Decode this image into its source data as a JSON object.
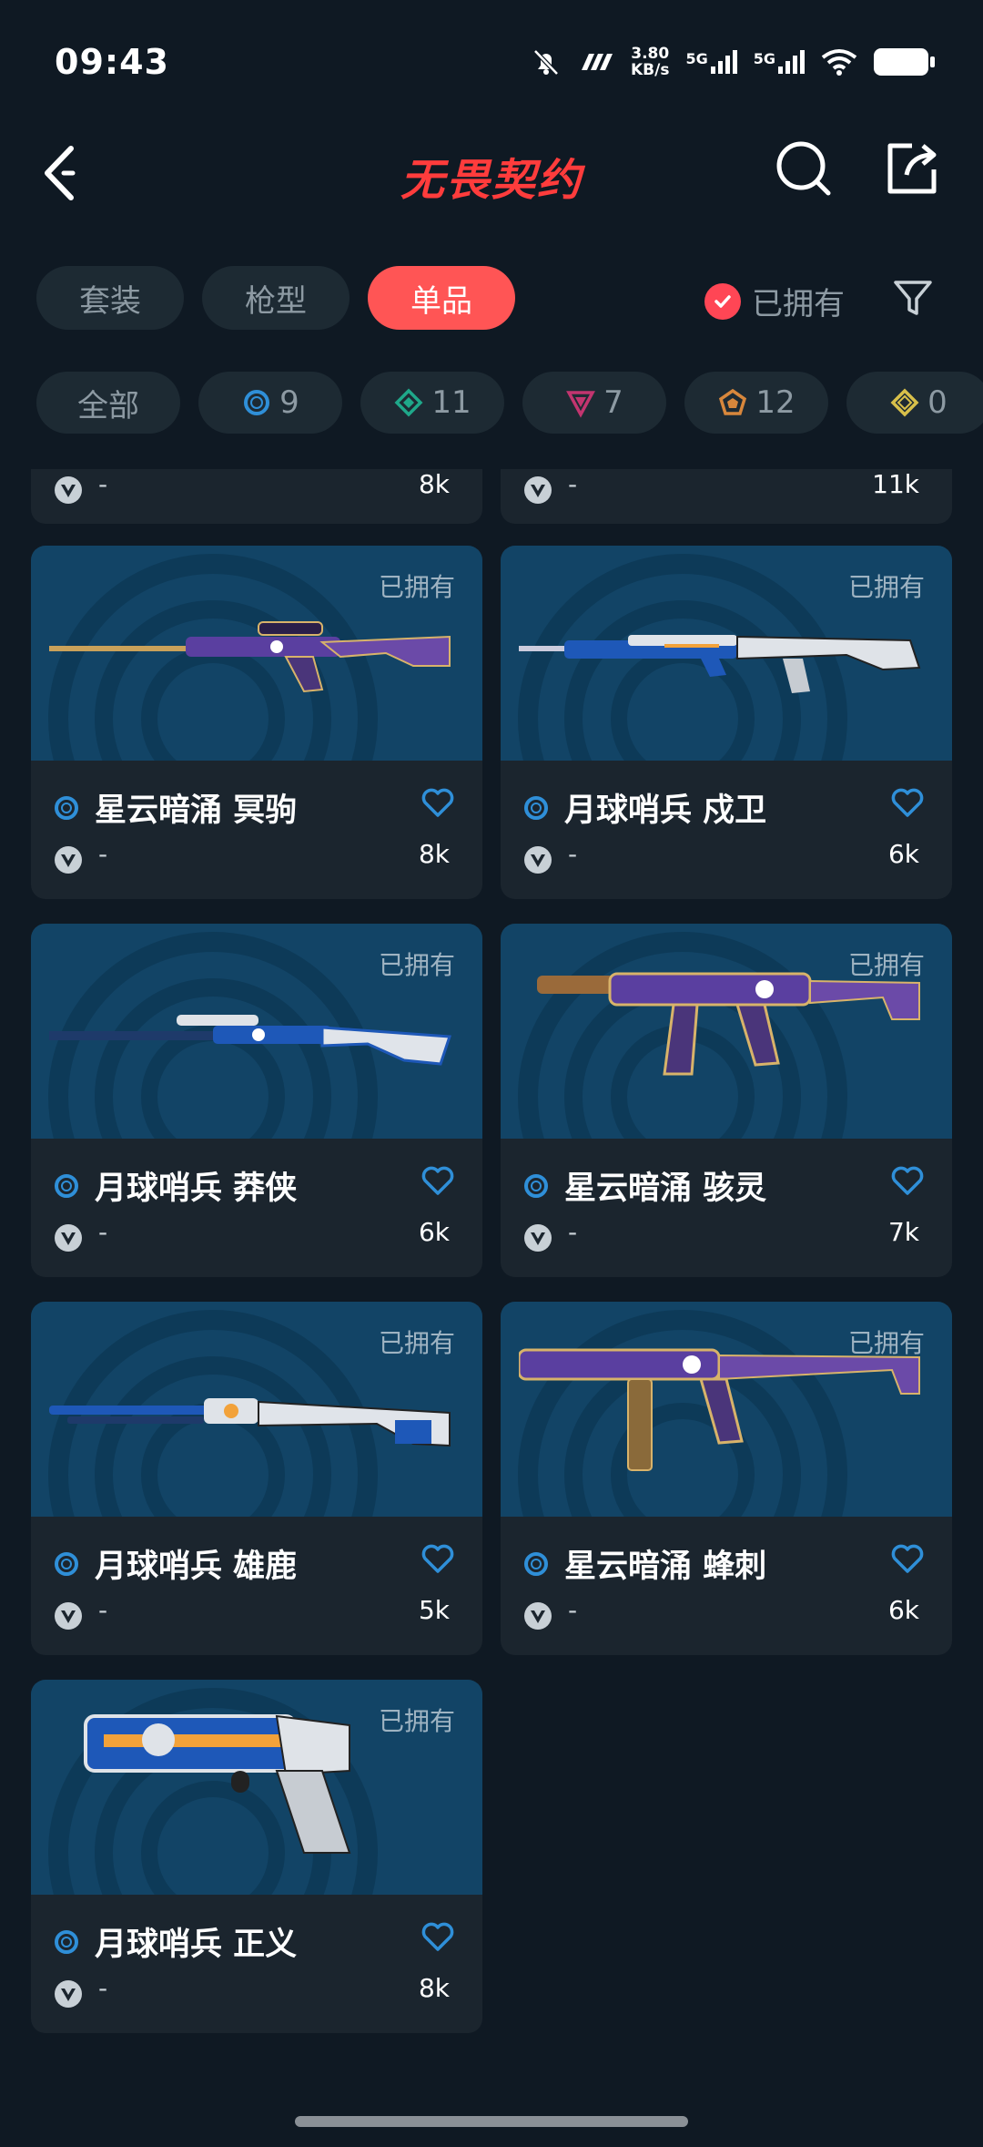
{
  "status_bar": {
    "time": "09:43",
    "net_speed_value": "3.80",
    "net_speed_unit": "KB/s",
    "sig1": "5G",
    "sig2": "5G"
  },
  "header": {
    "logo": "无畏契约"
  },
  "tabs": [
    {
      "label": "套装",
      "active": false
    },
    {
      "label": "枪型",
      "active": false
    },
    {
      "label": "单品",
      "active": true
    }
  ],
  "owned_toggle": {
    "label": "已拥有",
    "checked": true
  },
  "tier_filters": [
    {
      "label": "全部"
    },
    {
      "icon": "select-tier-icon",
      "color": "#2f8fd8",
      "count": "9"
    },
    {
      "icon": "deluxe-tier-icon",
      "color": "#1fa88a",
      "count": "11"
    },
    {
      "icon": "premium-tier-icon",
      "color": "#c2356f",
      "count": "7"
    },
    {
      "icon": "exclusive-tier-icon",
      "color": "#d8873c",
      "count": "12"
    },
    {
      "icon": "ultra-tier-icon",
      "color": "#d8c04a",
      "count": "0"
    }
  ],
  "partial_cards": [
    {
      "dash": "-",
      "price": "8k"
    },
    {
      "dash": "-",
      "price": "11k"
    }
  ],
  "cards": [
    {
      "owned": "已拥有",
      "name": "星云暗涌 冥驹",
      "dash": "-",
      "price": "8k",
      "gun": "sniper-nebula"
    },
    {
      "owned": "已拥有",
      "name": "月球哨兵 戍卫",
      "dash": "-",
      "price": "6k",
      "gun": "rifle-lunar"
    },
    {
      "owned": "已拥有",
      "name": "月球哨兵 莽侠",
      "dash": "-",
      "price": "6k",
      "gun": "marshal-lunar"
    },
    {
      "owned": "已拥有",
      "name": "星云暗涌 骇灵",
      "dash": "-",
      "price": "7k",
      "gun": "spectre-nebula"
    },
    {
      "owned": "已拥有",
      "name": "月球哨兵 雄鹿",
      "dash": "-",
      "price": "5k",
      "gun": "bucky-lunar"
    },
    {
      "owned": "已拥有",
      "name": "星云暗涌 蜂刺",
      "dash": "-",
      "price": "6k",
      "gun": "stinger-nebula"
    },
    {
      "owned": "已拥有",
      "name": "月球哨兵 正义",
      "dash": "-",
      "price": "8k",
      "gun": "sheriff-lunar"
    }
  ],
  "colors": {
    "accent": "#ff5555",
    "background": "#0f1923",
    "card": "#1b252e",
    "tier_select": "#2f8fd8"
  }
}
